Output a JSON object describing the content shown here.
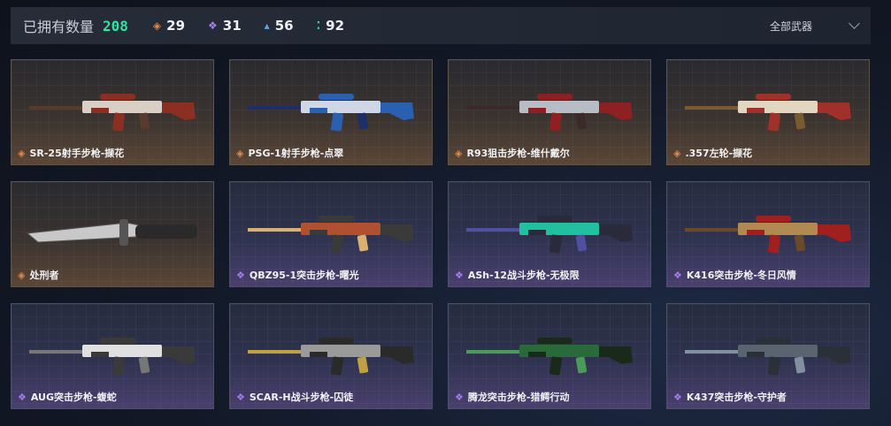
{
  "header": {
    "owned_label": "已拥有数量",
    "owned_count": "208",
    "stats": [
      {
        "icon": "orange-diamond-icon",
        "glyph": "◈",
        "color": "#e08a4e",
        "value": "29"
      },
      {
        "icon": "purple-diamond-icon",
        "glyph": "❖",
        "color": "#a77df0",
        "value": "31"
      },
      {
        "icon": "blue-triangle-icon",
        "glyph": "▴",
        "color": "#5aa6e6",
        "value": "56"
      },
      {
        "icon": "green-dots-icon",
        "glyph": "⁚",
        "color": "#3fd0a0",
        "value": "92"
      }
    ],
    "filter_label": "全部武器"
  },
  "weapons": [
    {
      "name": "SR-25射手步枪-撷花",
      "rarity": "gold"
    },
    {
      "name": "PSG-1射手步枪-点翠",
      "rarity": "gold"
    },
    {
      "name": "R93狙击步枪-维什戴尔",
      "rarity": "gold"
    },
    {
      "name": ".357左轮-撷花",
      "rarity": "gold"
    },
    {
      "name": "处刑者",
      "rarity": "gold"
    },
    {
      "name": "QBZ95-1突击步枪-曙光",
      "rarity": "purple"
    },
    {
      "name": "ASh-12战斗步枪-无极限",
      "rarity": "purple"
    },
    {
      "name": "K416突击步枪-冬日风情",
      "rarity": "purple"
    },
    {
      "name": "AUG突击步枪-蝮蛇",
      "rarity": "purple"
    },
    {
      "name": "SCAR-H战斗步枪-囚徒",
      "rarity": "purple"
    },
    {
      "name": "腾龙突击步枪-猎鳄行动",
      "rarity": "purple"
    },
    {
      "name": "K437突击步枪-守护者",
      "rarity": "purple"
    }
  ],
  "colors": {
    "accent_green": "#2fe3a0",
    "gold": "#e08a4e",
    "purple": "#a77df0"
  }
}
